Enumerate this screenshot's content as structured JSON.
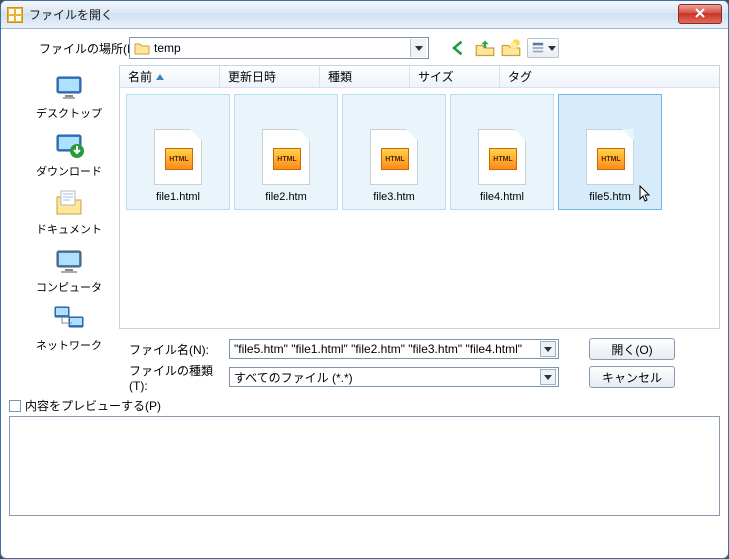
{
  "window": {
    "title": "ファイルを開く"
  },
  "location": {
    "label": "ファイルの場所(I):",
    "value": "temp"
  },
  "columns": {
    "name": "名前",
    "date": "更新日時",
    "type": "種類",
    "size": "サイズ",
    "tag": "タグ"
  },
  "sidebar": {
    "items": [
      {
        "label": "デスクトップ"
      },
      {
        "label": "ダウンロード"
      },
      {
        "label": "ドキュメント"
      },
      {
        "label": "コンピュータ"
      },
      {
        "label": "ネットワーク"
      }
    ]
  },
  "files": [
    {
      "label": "file1.html",
      "selected": false
    },
    {
      "label": "file2.htm",
      "selected": false
    },
    {
      "label": "file3.htm",
      "selected": false
    },
    {
      "label": "file4.html",
      "selected": false
    },
    {
      "label": "file5.htm",
      "selected": true
    }
  ],
  "filename": {
    "label": "ファイル名(N):",
    "value": "\"file5.htm\" \"file1.html\" \"file2.htm\" \"file3.htm\" \"file4.html\""
  },
  "filetype": {
    "label": "ファイルの種類(T):",
    "value": "すべてのファイル (*.*)"
  },
  "buttons": {
    "open": "開く(O)",
    "cancel": "キャンセル"
  },
  "preview": {
    "label": "内容をプレビューする(P)"
  }
}
